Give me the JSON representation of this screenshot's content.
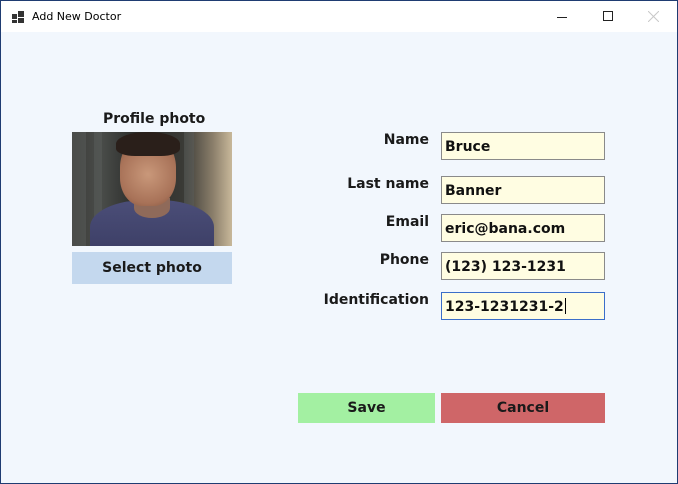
{
  "window": {
    "title": "Add New Doctor",
    "controls": {
      "minimize": "minimize-icon",
      "maximize": "maximize-icon",
      "close": "close-icon"
    }
  },
  "profile": {
    "label": "Profile photo",
    "select_button": "Select photo"
  },
  "form": {
    "fields": [
      {
        "label": "Name",
        "value": "Bruce"
      },
      {
        "label": "Last name",
        "value": "Banner"
      },
      {
        "label": "Email",
        "value": "eric@bana.com"
      },
      {
        "label": "Phone",
        "value": "(123) 123-1231"
      },
      {
        "label": "Identification",
        "value": "123-1231231-2"
      }
    ]
  },
  "actions": {
    "save": "Save",
    "cancel": "Cancel"
  },
  "colors": {
    "window_bg": "#f2f7fd",
    "field_bg": "#fffde2",
    "select_button": "#c4d8ee",
    "save_button": "#a3f0a2",
    "cancel_button": "#cf6668"
  }
}
